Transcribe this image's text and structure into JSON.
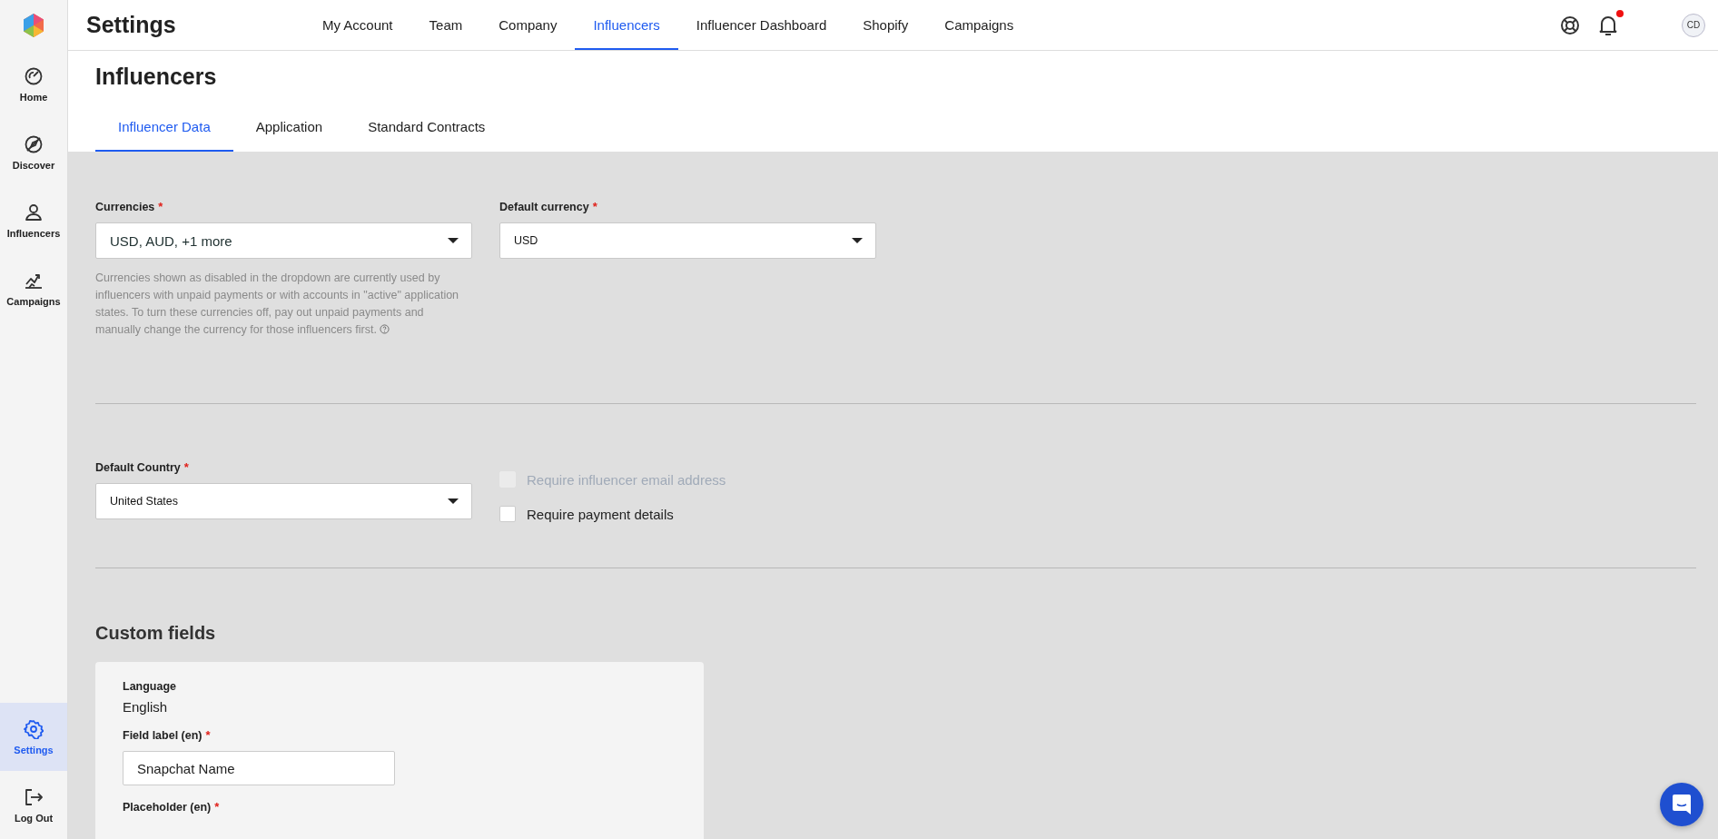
{
  "sidebar": {
    "items": [
      {
        "label": "Home",
        "selected": false
      },
      {
        "label": "Discover",
        "selected": false
      },
      {
        "label": "Influencers",
        "selected": false
      },
      {
        "label": "Campaigns",
        "selected": false
      }
    ],
    "bottom_items": [
      {
        "label": "Settings",
        "selected": true
      },
      {
        "label": "Log Out",
        "selected": false
      }
    ]
  },
  "header": {
    "title": "Settings",
    "tabs": [
      {
        "label": "My Account",
        "selected": false
      },
      {
        "label": "Team",
        "selected": false
      },
      {
        "label": "Company",
        "selected": false
      },
      {
        "label": "Influencers",
        "selected": true
      },
      {
        "label": "Influencer Dashboard",
        "selected": false
      },
      {
        "label": "Shopify",
        "selected": false
      },
      {
        "label": "Campaigns",
        "selected": false
      }
    ],
    "notification_unread": true,
    "avatar": "CD"
  },
  "page": {
    "title": "Influencers",
    "tabs": [
      {
        "label": "Influencer Data",
        "selected": true
      },
      {
        "label": "Application",
        "selected": false
      },
      {
        "label": "Standard Contracts",
        "selected": false
      }
    ]
  },
  "currencies": {
    "label": "Currencies",
    "required_mark": "*",
    "value": "USD, AUD, +1 more",
    "help": "Currencies shown as disabled in the dropdown are currently used by influencers with unpaid payments or with accounts in \"active\" application states. To turn these currencies off, pay out unpaid payments and manually change the currency for those influencers first."
  },
  "default_currency": {
    "label": "Default currency",
    "required_mark": "*",
    "value": "USD"
  },
  "default_country": {
    "label": "Default Country",
    "required_mark": "*",
    "value": "United States"
  },
  "checkboxes": [
    {
      "label": "Require influencer email address",
      "checked": false,
      "disabled": true
    },
    {
      "label": "Require payment details",
      "checked": false,
      "disabled": false
    }
  ],
  "custom_fields": {
    "title": "Custom fields",
    "language_label": "Language",
    "language": "English",
    "field_label": {
      "label": "Field label (en)",
      "required_mark": "*",
      "value": "Snapchat Name"
    },
    "placeholder_label": {
      "label": "Placeholder (en)",
      "required_mark": "*"
    }
  }
}
